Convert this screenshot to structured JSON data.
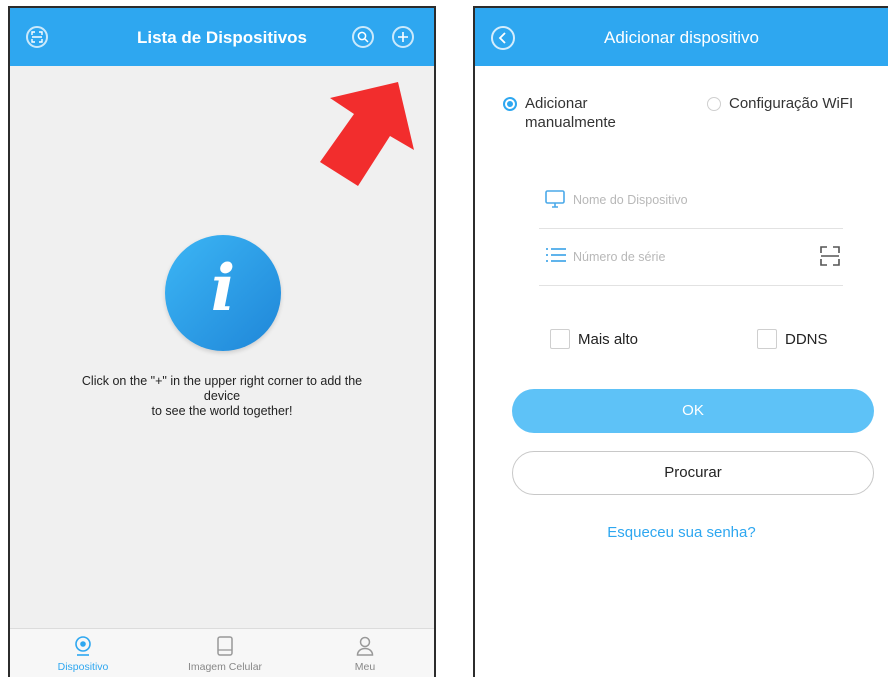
{
  "device_list": {
    "header": {
      "title": "Lista de Dispositivos",
      "left_icon": "scan-icon",
      "search_icon": "search-icon",
      "add_icon": "plus-icon"
    },
    "empty_state": {
      "icon_letter": "i",
      "message_line1": "Click on the \"+\" in the upper right corner to add the",
      "message_line2": "device",
      "message_line3": "to see the world together!"
    },
    "tabs": [
      {
        "label": "Dispositivo",
        "icon": "camera-icon",
        "active": true
      },
      {
        "label": "Imagem Celular",
        "icon": "tablet-icon",
        "active": false
      },
      {
        "label": "Meu",
        "icon": "user-icon",
        "active": false
      }
    ]
  },
  "add_device": {
    "header": {
      "title": "Adicionar dispositivo",
      "back_icon": "back-arrow-icon"
    },
    "radio_options": [
      {
        "label_line1": "Adicionar",
        "label_line2": "manualmente",
        "selected": true
      },
      {
        "label": "Configuração WiFI",
        "selected": false
      }
    ],
    "fields": {
      "device_name_placeholder": "Nome do Dispositivo",
      "serial_placeholder": "Número de série"
    },
    "checkboxes": {
      "higher_label": "Mais alto",
      "ddns_label": "DDNS"
    },
    "ok_button": "OK",
    "search_button": "Procurar",
    "forgot_link": "Esqueceu sua senha?"
  },
  "colors": {
    "header_blue": "#2ea7f0",
    "ok_button_blue": "#5ec2f7",
    "arrow_red": "#f22d2d"
  }
}
